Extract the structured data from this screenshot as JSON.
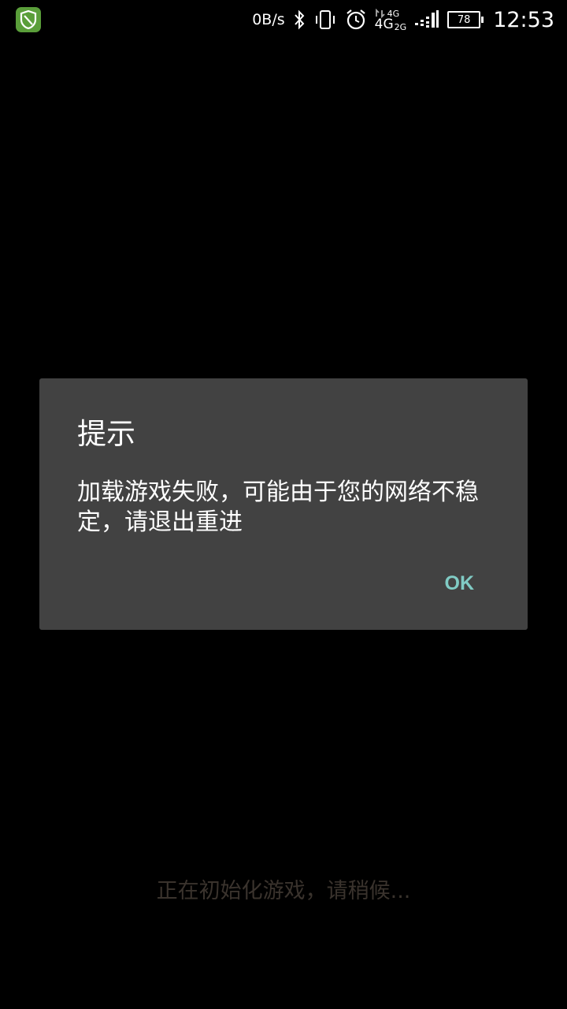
{
  "status_bar": {
    "net_speed": "0B/s",
    "signal_top": "4G",
    "signal_big": "4G",
    "signal_small": "2G",
    "battery": "78",
    "time": "12:53"
  },
  "dialog": {
    "title": "提示",
    "message": "加载游戏失败，可能由于您的网络不稳定，请退出重进",
    "ok_label": "OK"
  },
  "loading_text": "正在初始化游戏，请稍候...",
  "colors": {
    "background": "#000000",
    "dialog_bg": "#424242",
    "ok_accent": "#80cbc4",
    "app_icon": "#5a9e3a"
  }
}
